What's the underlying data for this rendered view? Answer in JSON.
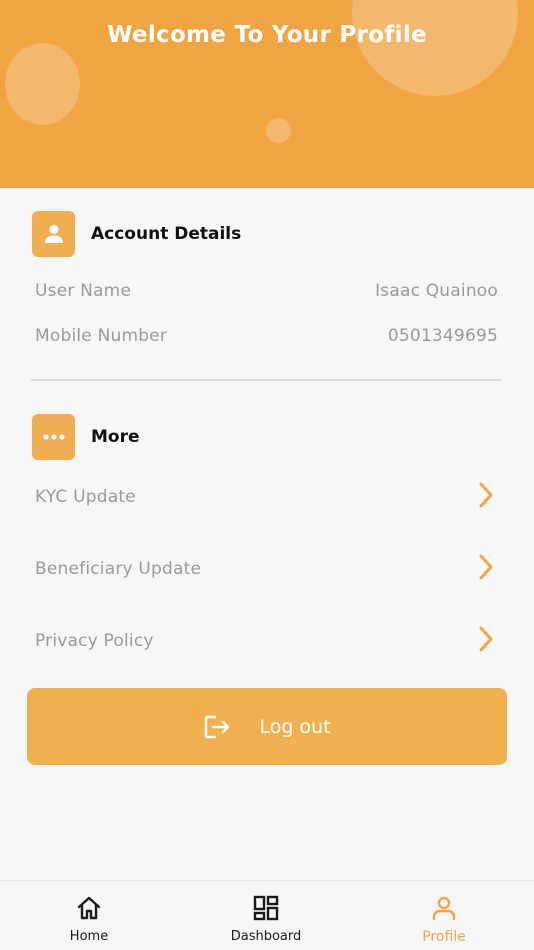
{
  "header": {
    "title": "Welcome To Your Profile"
  },
  "account": {
    "section_title": "Account Details",
    "icon": "user-icon",
    "rows": [
      {
        "label": "User Name",
        "value": "Isaac Quainoo"
      },
      {
        "label": "Mobile Number",
        "value": "0501349695"
      }
    ]
  },
  "more": {
    "section_title": "More",
    "icon": "more-dots-icon",
    "items": [
      {
        "label": "KYC Update"
      },
      {
        "label": "Beneficiary Update"
      },
      {
        "label": "Privacy Policy"
      }
    ]
  },
  "logout": {
    "label": "Log out",
    "icon": "logout-icon"
  },
  "nav": {
    "items": [
      {
        "label": "Home",
        "icon": "home-icon"
      },
      {
        "label": "Dashboard",
        "icon": "dashboard-icon"
      },
      {
        "label": "Profile",
        "icon": "profile-icon",
        "active": true
      }
    ]
  },
  "colors": {
    "accent": "#f0a442",
    "muted_text": "#999999"
  }
}
